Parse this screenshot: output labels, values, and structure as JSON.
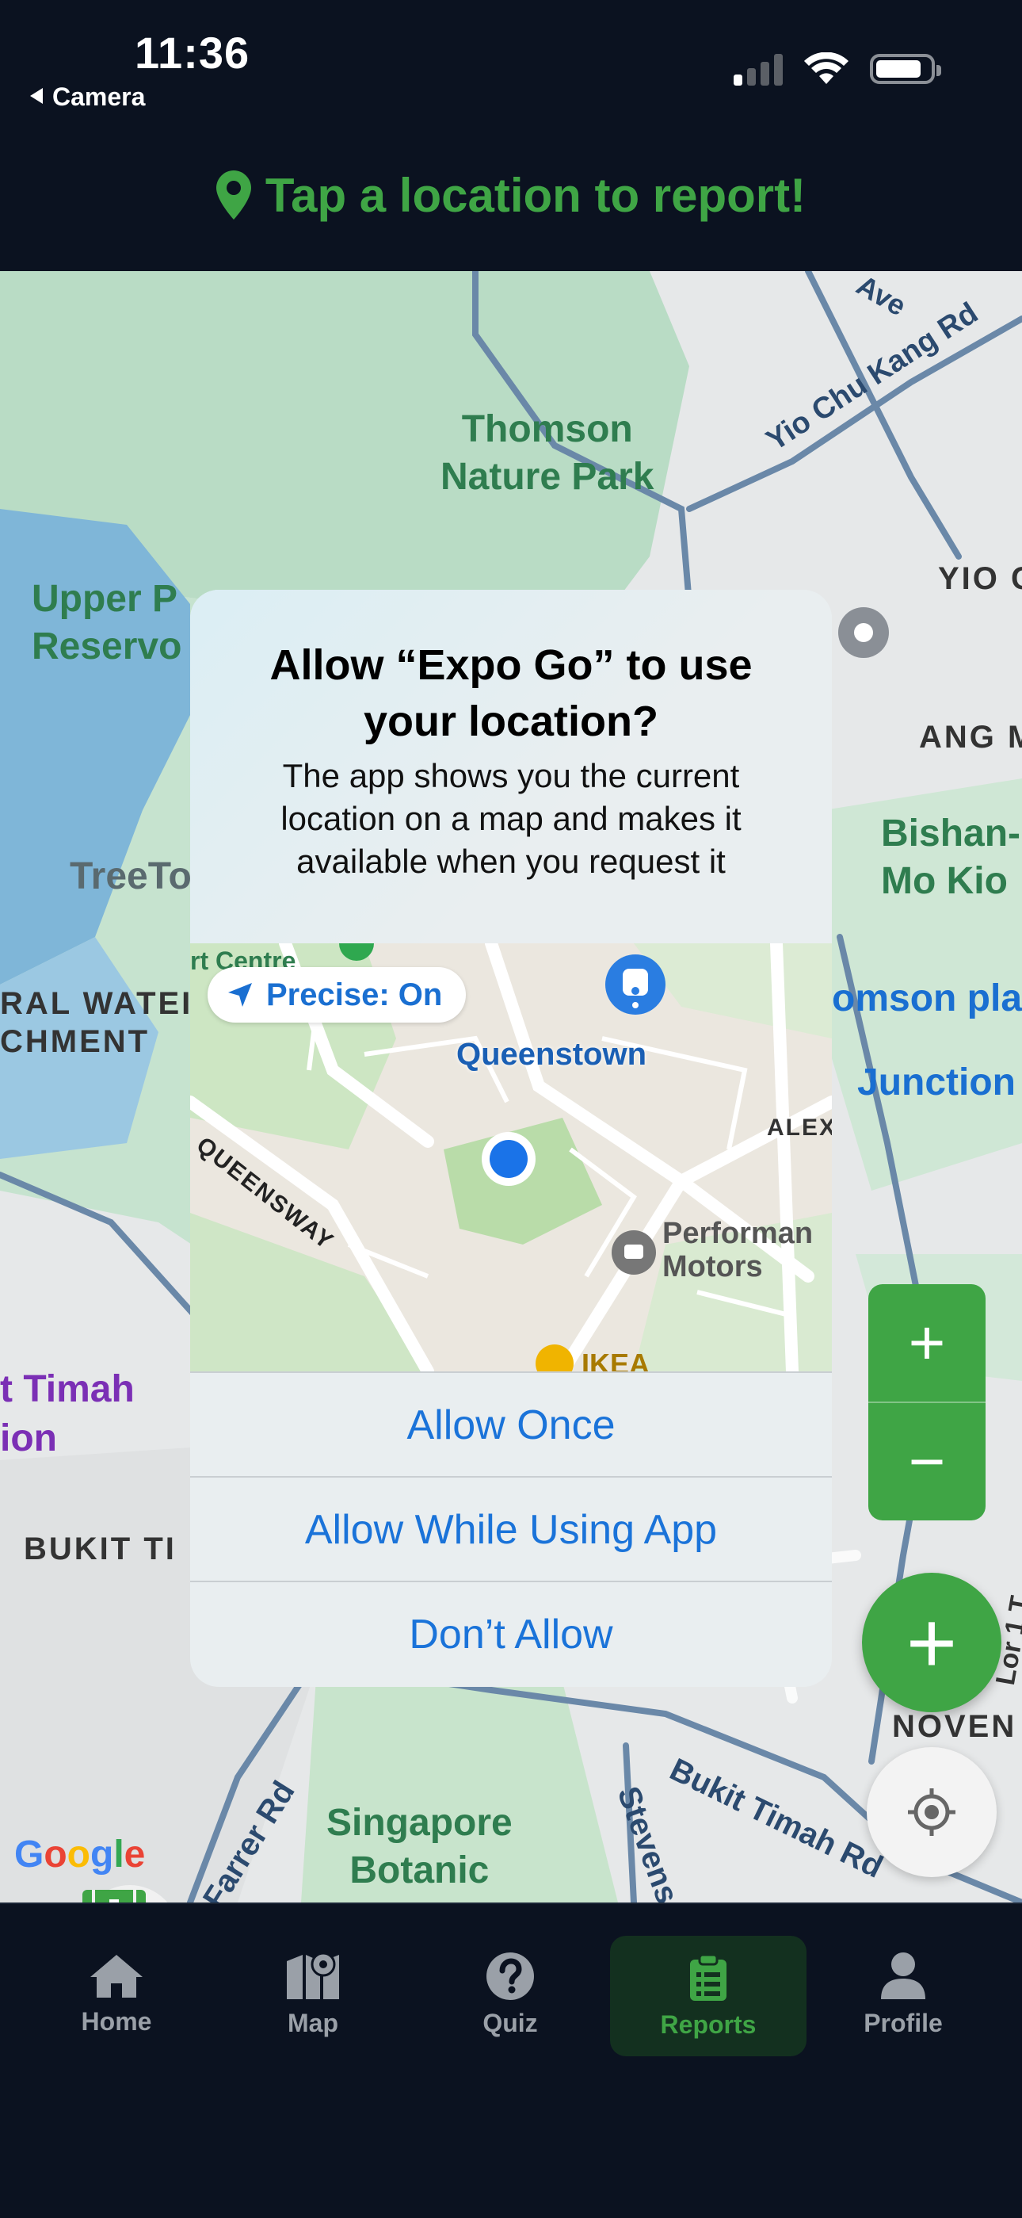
{
  "status_bar": {
    "time": "11:36",
    "back_app": "Camera",
    "icons": [
      "cellular-signal-icon",
      "wifi-icon",
      "battery-icon"
    ]
  },
  "banner": {
    "icon": "map-pin-icon",
    "text": "Tap a location to report!",
    "color": "#3fa545"
  },
  "map": {
    "labels": {
      "thomson_park": "Thomson\nNature Park",
      "yio_chu_kang": "Yio Chu Kang Rd",
      "ave": "Ave",
      "yio": "YIO C",
      "upper_reservoir": "Upper P\nReservo",
      "ang_mo": "ANG M",
      "bishan": "Bishan-\nMo Kio",
      "treetop": "TreeTo",
      "central_water": "RAL WATEI\nCHMENT",
      "thomson_plaza": "omson pla",
      "junction": "Junction",
      "bukit_timah_station": "t Timah\nion",
      "bukit_ti": "BUKIT TI",
      "lor1": "Lor 1 T",
      "novena": "NOVEN",
      "bukit_timah_rd": "Bukit Timah Rd",
      "farrer_rd": "Farrer Rd",
      "stevens_rd": "Stevens Rd",
      "botanic": "Singapore\nBotanic",
      "google": "Google"
    }
  },
  "controls": {
    "zoom_in": "+",
    "zoom_out": "−",
    "add": "+"
  },
  "dialog": {
    "title": "Allow “Expo Go” to use your location?",
    "body": "The app shows you the current location on a map and makes it available when you request it",
    "precise": "Precise: On",
    "minimap_labels": {
      "queenstown": "Queenstown",
      "queensway": "QUEENSWAY",
      "alex": "ALEX",
      "performance": "Performan\nMotors",
      "ikea": "IKEA",
      "sport_centre": "rt Centre"
    },
    "buttons": [
      "Allow Once",
      "Allow While Using App",
      "Don’t Allow"
    ]
  },
  "tabs": [
    {
      "label": "Home",
      "icon": "home-icon",
      "active": false
    },
    {
      "label": "Map",
      "icon": "map-icon",
      "active": false
    },
    {
      "label": "Quiz",
      "icon": "question-circle-icon",
      "active": false
    },
    {
      "label": "Reports",
      "icon": "clipboard-list-icon",
      "active": true
    },
    {
      "label": "Profile",
      "icon": "user-icon",
      "active": false
    }
  ],
  "colors": {
    "brand_green": "#3fa545",
    "tab_bg": "#0b1220",
    "active_tab_bg": "#13301f",
    "link_blue": "#1a73d9"
  }
}
